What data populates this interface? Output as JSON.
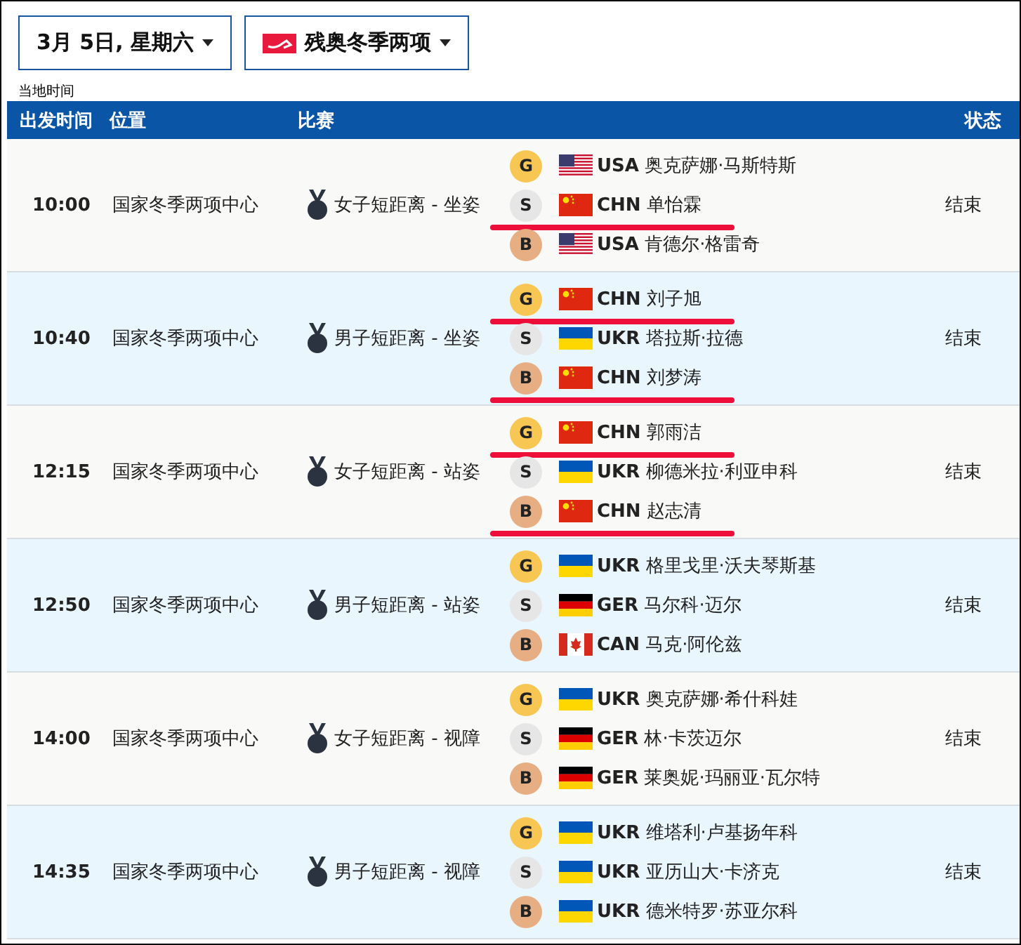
{
  "filters": {
    "date": "3月 5日, 星期六",
    "sport": "残奥冬季两项"
  },
  "timezone_note": "当地时间",
  "table": {
    "columns": [
      "出发时间",
      "位置",
      "比赛",
      "状态"
    ],
    "rows": [
      {
        "time": "10:00",
        "venue": "国家冬季两项中心",
        "event": "女子短距离 - 坐姿",
        "status": "结束",
        "results": [
          {
            "medal": "G",
            "kind": "usa",
            "country": "USA",
            "athlete": "奥克萨娜·马斯特斯",
            "underlined": false
          },
          {
            "medal": "S",
            "kind": "chn",
            "country": "CHN",
            "athlete": "单怡霖",
            "underlined": true
          },
          {
            "medal": "B",
            "kind": "usa",
            "country": "USA",
            "athlete": "肯德尔·格雷奇",
            "underlined": false
          }
        ]
      },
      {
        "time": "10:40",
        "venue": "国家冬季两项中心",
        "event": "男子短距离 - 坐姿",
        "status": "结束",
        "results": [
          {
            "medal": "G",
            "kind": "chn",
            "country": "CHN",
            "athlete": "刘子旭",
            "underlined": true
          },
          {
            "medal": "S",
            "kind": "ukr",
            "country": "UKR",
            "athlete": "塔拉斯·拉德",
            "underlined": false
          },
          {
            "medal": "B",
            "kind": "chn",
            "country": "CHN",
            "athlete": "刘梦涛",
            "underlined": true
          }
        ]
      },
      {
        "time": "12:15",
        "venue": "国家冬季两项中心",
        "event": "女子短距离 - 站姿",
        "status": "结束",
        "results": [
          {
            "medal": "G",
            "kind": "chn",
            "country": "CHN",
            "athlete": "郭雨洁",
            "underlined": true
          },
          {
            "medal": "S",
            "kind": "ukr",
            "country": "UKR",
            "athlete": "柳德米拉·利亚申科",
            "underlined": false
          },
          {
            "medal": "B",
            "kind": "chn",
            "country": "CHN",
            "athlete": "赵志清",
            "underlined": true
          }
        ]
      },
      {
        "time": "12:50",
        "venue": "国家冬季两项中心",
        "event": "男子短距离 - 站姿",
        "status": "结束",
        "results": [
          {
            "medal": "G",
            "kind": "ukr",
            "country": "UKR",
            "athlete": "格里戈里·沃夫琴斯基",
            "underlined": false
          },
          {
            "medal": "S",
            "kind": "ger",
            "country": "GER",
            "athlete": "马尔科·迈尔",
            "underlined": false
          },
          {
            "medal": "B",
            "kind": "can",
            "country": "CAN",
            "athlete": "马克·阿伦兹",
            "underlined": false
          }
        ]
      },
      {
        "time": "14:00",
        "venue": "国家冬季两项中心",
        "event": "女子短距离 - 视障",
        "status": "结束",
        "results": [
          {
            "medal": "G",
            "kind": "ukr",
            "country": "UKR",
            "athlete": "奥克萨娜·希什科娃",
            "underlined": false
          },
          {
            "medal": "S",
            "kind": "ger",
            "country": "GER",
            "athlete": "林·卡茨迈尔",
            "underlined": false
          },
          {
            "medal": "B",
            "kind": "ger",
            "country": "GER",
            "athlete": "莱奥妮·玛丽亚·瓦尔特",
            "underlined": false
          }
        ]
      },
      {
        "time": "14:35",
        "venue": "国家冬季两项中心",
        "event": "男子短距离 - 视障",
        "status": "结束",
        "results": [
          {
            "medal": "G",
            "kind": "ukr",
            "country": "UKR",
            "athlete": "维塔利·卢基扬年科",
            "underlined": false
          },
          {
            "medal": "S",
            "kind": "ukr",
            "country": "UKR",
            "athlete": "亚历山大·卡济克",
            "underlined": false
          },
          {
            "medal": "B",
            "kind": "ukr",
            "country": "UKR",
            "athlete": "德米特罗·苏亚尔科",
            "underlined": false
          }
        ]
      }
    ]
  }
}
